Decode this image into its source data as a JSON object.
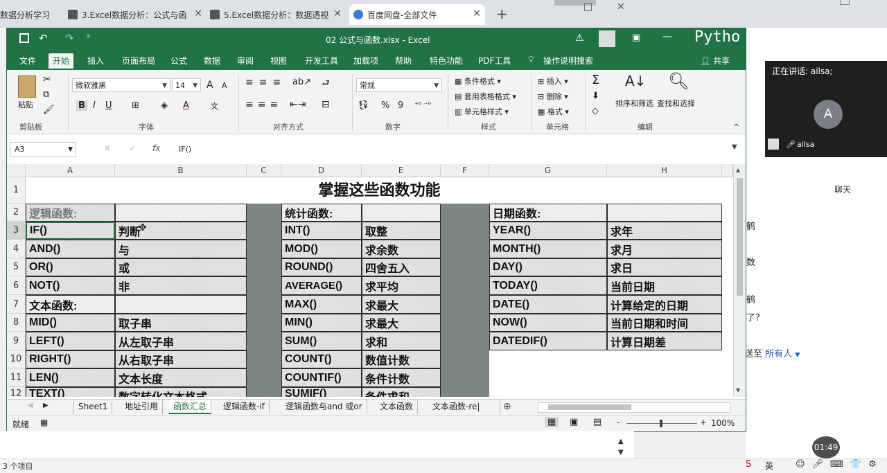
{
  "browser": {
    "tabs": [
      {
        "label": "数据分析学习"
      },
      {
        "label": "3.Excel数据分析：公式与函"
      },
      {
        "label": "5.Excel数据分析：数据透视"
      },
      {
        "label": "百度网盘-全部文件"
      }
    ],
    "new_tab": "+"
  },
  "excel": {
    "title": "02 公式与函数.xlsx  -  Excel",
    "python_overlay": "Pytho",
    "menu": [
      "文件",
      "开始",
      "插入",
      "页面布局",
      "公式",
      "数据",
      "审阅",
      "视图",
      "开发工具",
      "加载项",
      "帮助",
      "特色功能",
      "PDF工具",
      "操作说明搜索"
    ],
    "share": "共享",
    "ribbon": {
      "clipboard": {
        "paste": "粘贴",
        "label": "剪贴板"
      },
      "font": {
        "name": "微软雅黑",
        "size": "14",
        "bold": "B",
        "italic": "I",
        "underline": "U",
        "label": "字体",
        "grow": "A",
        "shrink": "A"
      },
      "align": {
        "label": "对齐方式"
      },
      "number": {
        "format": "常规",
        "percent": "%",
        "comma": "9",
        "label": "数字"
      },
      "styles": {
        "cond": "条件格式",
        "table": "套用表格格式",
        "cell": "单元格样式",
        "label": "样式"
      },
      "cells": {
        "insert": "插入",
        "delete": "删除",
        "format": "格式",
        "label": "单元格"
      },
      "edit": {
        "sort": "排序和筛选",
        "find": "查找和选择",
        "label": "编辑"
      }
    },
    "formula_bar": {
      "name_box": "A3",
      "fx": "fx",
      "formula": "IF()"
    },
    "columns": [
      "A",
      "B",
      "C",
      "D",
      "E",
      "F",
      "G",
      "H"
    ],
    "title_row": "掌握这些函数功能",
    "row_numbers": [
      "1",
      "2",
      "3",
      "4",
      "5",
      "6",
      "7",
      "8",
      "9",
      "10",
      "11",
      "12"
    ],
    "logic": {
      "header": "逻辑函数:",
      "rows": [
        [
          "IF()",
          "判断"
        ],
        [
          "AND()",
          "与"
        ],
        [
          "OR()",
          "或"
        ],
        [
          "NOT()",
          "非"
        ]
      ]
    },
    "text": {
      "header": "文本函数:",
      "rows": [
        [
          "MID()",
          "取子串"
        ],
        [
          "LEFT()",
          "从左取子串"
        ],
        [
          "RIGHT()",
          "从右取子串"
        ],
        [
          "LEN()",
          "文本长度"
        ],
        [
          "TEXT()",
          "数字转化文本格式"
        ]
      ]
    },
    "stats": {
      "header": "统计函数:",
      "rows": [
        [
          "INT()",
          "取整"
        ],
        [
          "MOD()",
          "求余数"
        ],
        [
          "ROUND()",
          "四舍五入"
        ],
        [
          "AVERAGE()",
          "求平均"
        ],
        [
          "MAX()",
          "求最大"
        ],
        [
          "MIN()",
          "求最大"
        ],
        [
          "SUM()",
          "求和"
        ],
        [
          "COUNT()",
          "数值计数"
        ],
        [
          "COUNTIF()",
          "条件计数"
        ],
        [
          "SUMIF()",
          "条件求和"
        ]
      ]
    },
    "date": {
      "header": "日期函数:",
      "rows": [
        [
          "YEAR()",
          "求年"
        ],
        [
          "MONTH()",
          "求月"
        ],
        [
          "DAY()",
          "求日"
        ],
        [
          "TODAY()",
          "当前日期"
        ],
        [
          "DATE()",
          "计算给定的日期"
        ],
        [
          "NOW()",
          "当前日期和时间"
        ],
        [
          "DATEDIF()",
          "计算日期差"
        ]
      ]
    },
    "sheets": [
      "Sheet1",
      "地址引用",
      "函数汇总",
      "逻辑函数-if",
      "逻辑函数与and 或or",
      "文本函数",
      "文本函数-re|"
    ],
    "active_sheet": "函数汇总",
    "status": {
      "ready": "就绪",
      "zoom": "100%",
      "minus": "-",
      "plus": "+"
    }
  },
  "meeting": {
    "speaking": "正在讲话: ailsa;",
    "avatar_letter": "A",
    "user": "ailsa",
    "chat_title": "聊天",
    "chat_fragments": [
      "鹤",
      "数",
      "鹤",
      "了?"
    ],
    "send_to_label": "送至",
    "send_to_value": "所有人",
    "timer": "01:49"
  },
  "footer": {
    "items": "3 个项目",
    "ime": "英"
  },
  "colors": {
    "excel_green": "#217346",
    "hatch": "#d9d9d9",
    "gap": "#7c8784"
  }
}
